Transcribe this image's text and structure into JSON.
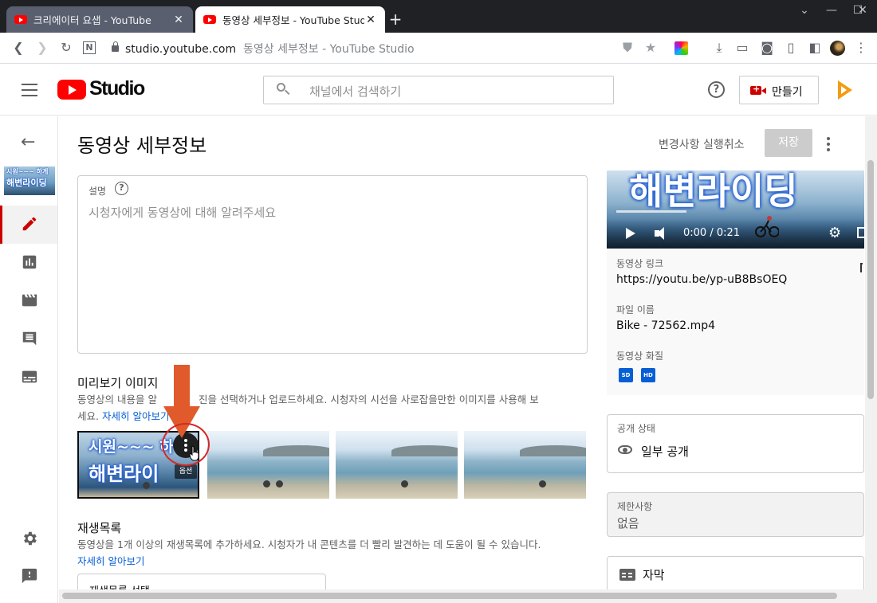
{
  "browser": {
    "tabs": [
      {
        "title": "크리에이터 요샙 - YouTube",
        "active": false
      },
      {
        "title": "동영상 세부정보 - YouTube Studio",
        "active": true
      }
    ],
    "url_host": "studio.youtube.com",
    "url_title": "동영상 세부정보 - YouTube Studio"
  },
  "header": {
    "logo_text": "Studio",
    "search_placeholder": "채널에서 검색하기",
    "help_glyph": "?",
    "create_label": "만들기"
  },
  "page": {
    "title": "동영상 세부정보",
    "undo_label": "변경사항 실행취소",
    "save_label": "저장"
  },
  "sidebar": {
    "thumb_line1": "시원~~~ 하게",
    "thumb_line2": "해변라이딩",
    "items": [
      {
        "name": "details",
        "icon": "pencil-icon",
        "selected": true
      },
      {
        "name": "analytics",
        "icon": "analytics-icon",
        "selected": false
      },
      {
        "name": "editor",
        "icon": "film-icon",
        "selected": false
      },
      {
        "name": "comments",
        "icon": "comment-icon",
        "selected": false
      },
      {
        "name": "subtitles",
        "icon": "subtitles-icon",
        "selected": false
      }
    ],
    "bottom": [
      {
        "name": "settings",
        "icon": "gear-icon"
      },
      {
        "name": "feedback",
        "icon": "feedback-icon"
      }
    ]
  },
  "description": {
    "label": "설명",
    "help_glyph": "?",
    "placeholder": "시청자에게 동영상에 대해 알려주세요"
  },
  "thumbnail": {
    "title": "미리보기 이미지",
    "help_line1": "동영상의 내용을 알",
    "help_line1_cont": "진을 선택하거나 업로드하세요. 시청자의 시선을 사로잡을만한 이미지를 사용해 보",
    "help_line2": "세요.",
    "learn_more": "자세히 알아보기",
    "selected_text1": "시원~~~ 하",
    "selected_text2": "해변라이",
    "selected_badge": "옵션",
    "options": 4
  },
  "playlist": {
    "title": "재생목록",
    "help": "동영상을 1개 이상의 재생목록에 추가하세요. 시청자가 내 콘텐츠를 더 빨리 발견하는 데 도움이 될 수 있습니다.",
    "learn_more": "자세히 알아보기",
    "select_value": "재생목록 선택"
  },
  "video": {
    "overlay_text": "해변라이딩",
    "time": "0:00 / 0:21",
    "link_label": "동영상 링크",
    "link": "https://youtu.be/yp-uB8BsOEQ",
    "file_label": "파일 이름",
    "file_name": "Bike - 72562.mp4",
    "quality_label": "동영상 화질",
    "qualities": [
      "SD",
      "HD"
    ]
  },
  "visibility": {
    "label": "공개 상태",
    "value": "일부 공개"
  },
  "restrictions": {
    "label": "제한사항",
    "value": "없음"
  },
  "subtitles": {
    "label": "자막"
  },
  "colors": {
    "brand_red": "#ff0000",
    "link_blue": "#065fd4",
    "annotation_arrow": "#e05a2b",
    "annotation_circle": "#d62828"
  }
}
